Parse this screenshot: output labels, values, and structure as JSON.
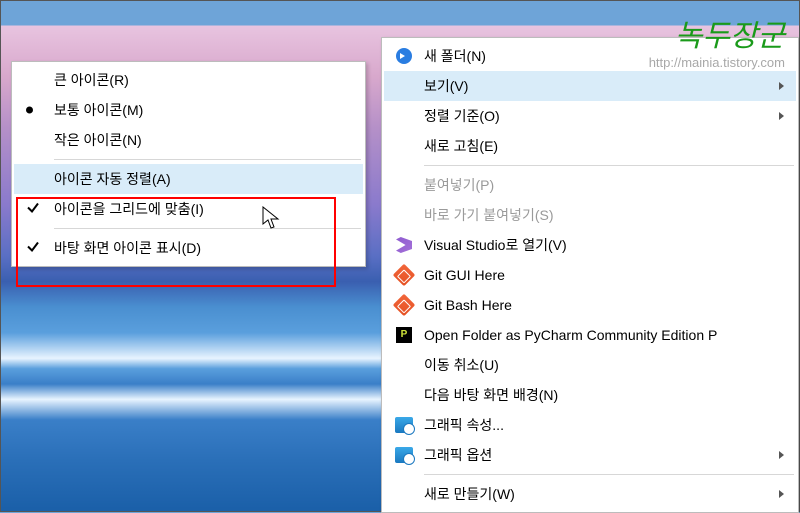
{
  "watermark": {
    "title": "녹두장군",
    "url": "http://mainia.tistory.com"
  },
  "submenu": {
    "items": [
      {
        "label": "큰 아이콘(R)",
        "marker": "",
        "highlighted": false
      },
      {
        "label": "보통 아이콘(M)",
        "marker": "bullet",
        "highlighted": false
      },
      {
        "label": "작은 아이콘(N)",
        "marker": "",
        "highlighted": false
      }
    ],
    "items2": [
      {
        "label": "아이콘 자동 정렬(A)",
        "marker": "",
        "highlighted": true
      },
      {
        "label": "아이콘을 그리드에 맞춤(I)",
        "marker": "check",
        "highlighted": false
      }
    ],
    "items3": [
      {
        "label": "바탕 화면 아이콘 표시(D)",
        "marker": "check",
        "highlighted": false
      }
    ]
  },
  "mainmenu": {
    "items": [
      {
        "label": "새 폴더(N)",
        "icon": "folder-icon",
        "disabled": false
      },
      {
        "label": "보기(V)",
        "icon": "",
        "disabled": false,
        "submenu": true,
        "highlighted": true
      },
      {
        "label": "정렬 기준(O)",
        "icon": "",
        "disabled": false,
        "submenu": true
      },
      {
        "label": "새로 고침(E)",
        "icon": "",
        "disabled": false
      }
    ],
    "items2": [
      {
        "label": "붙여넣기(P)",
        "icon": "",
        "disabled": true
      },
      {
        "label": "바로 가기 붙여넣기(S)",
        "icon": "",
        "disabled": true
      },
      {
        "label": "Visual Studio로 열기(V)",
        "icon": "vs-icon",
        "disabled": false
      },
      {
        "label": "Git GUI Here",
        "icon": "git-icon",
        "disabled": false
      },
      {
        "label": "Git Bash Here",
        "icon": "git-icon",
        "disabled": false
      },
      {
        "label": "Open Folder as PyCharm Community Edition P",
        "icon": "pycharm-icon",
        "disabled": false
      },
      {
        "label": "이동 취소(U)",
        "icon": "",
        "disabled": false
      },
      {
        "label": "다음 바탕 화면 배경(N)",
        "icon": "",
        "disabled": false
      },
      {
        "label": "그래픽 속성...",
        "icon": "intel-icon",
        "disabled": false
      },
      {
        "label": "그래픽 옵션",
        "icon": "intel-icon",
        "disabled": false,
        "submenu": true
      }
    ],
    "items3": [
      {
        "label": "새로 만들기(W)",
        "icon": "",
        "disabled": false,
        "submenu": true
      }
    ]
  }
}
